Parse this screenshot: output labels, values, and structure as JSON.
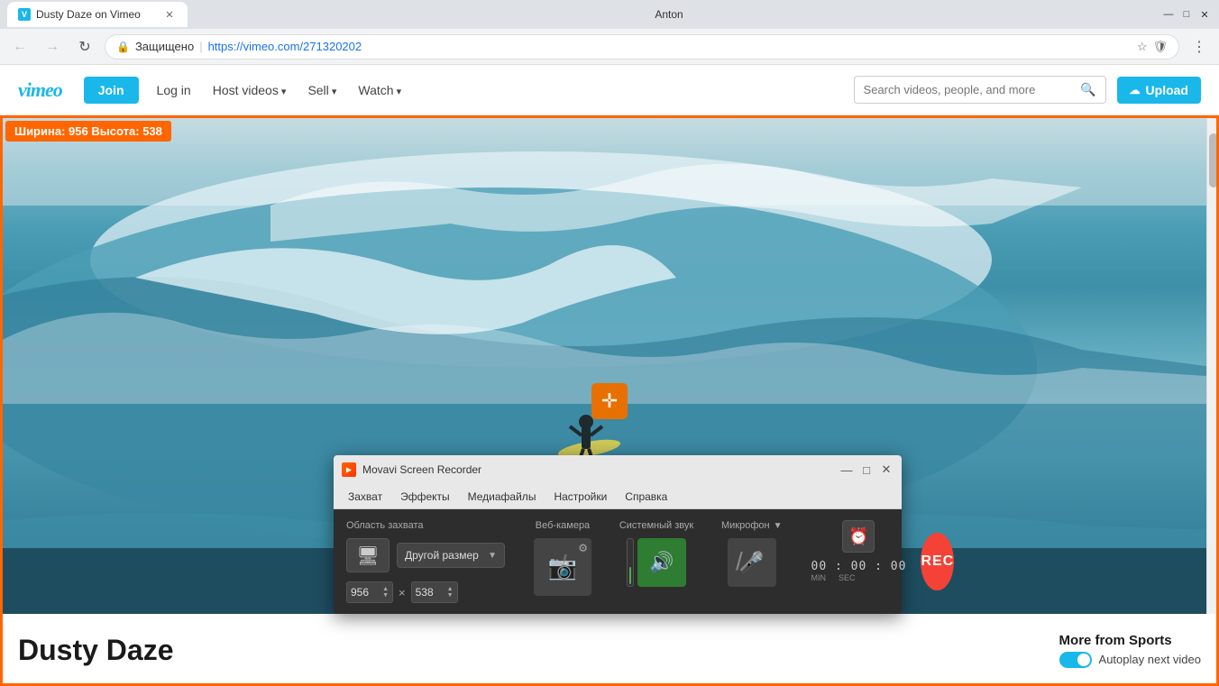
{
  "browser": {
    "tab_favicon": "V",
    "tab_title": "Dusty Daze on Vimeo",
    "user_name": "Anton",
    "address_secure_label": "Защищено",
    "address_url": "https://vimeo.com/271320202",
    "back_btn": "←",
    "forward_btn": "→",
    "reload_btn": "↻"
  },
  "vimeo_nav": {
    "logo": "vimeo",
    "join_label": "Join",
    "login_label": "Log in",
    "host_label": "Host videos",
    "sell_label": "Sell",
    "watch_label": "Watch",
    "search_placeholder": "Search videos, people, and more",
    "upload_label": "Upload"
  },
  "video": {
    "selection_label": "Ширина: 956  Высота: 538",
    "title": "Dusty Daze"
  },
  "sidebar": {
    "more_from": "More from Sports",
    "autoplay_label": "Autoplay next video"
  },
  "movavi": {
    "title": "Movavi Screen Recorder",
    "menu": {
      "capture": "Захват",
      "effects": "Эффекты",
      "media": "Медиафайлы",
      "settings": "Настройки",
      "help": "Справка"
    },
    "capture_area_label": "Область захвата",
    "size_dropdown": "Другой размер",
    "width_value": "956",
    "height_value": "538",
    "dim_separator": "×",
    "webcam_label": "Веб-камера",
    "system_sound_label": "Системный звук",
    "mic_label": "Микрофон",
    "timer_display": "00 : 00 : 00",
    "timer_min": "MIN",
    "timer_sec": "SEC",
    "rec_label": "REC",
    "minimize_btn": "—",
    "maximize_btn": "□",
    "close_btn": "✕"
  }
}
